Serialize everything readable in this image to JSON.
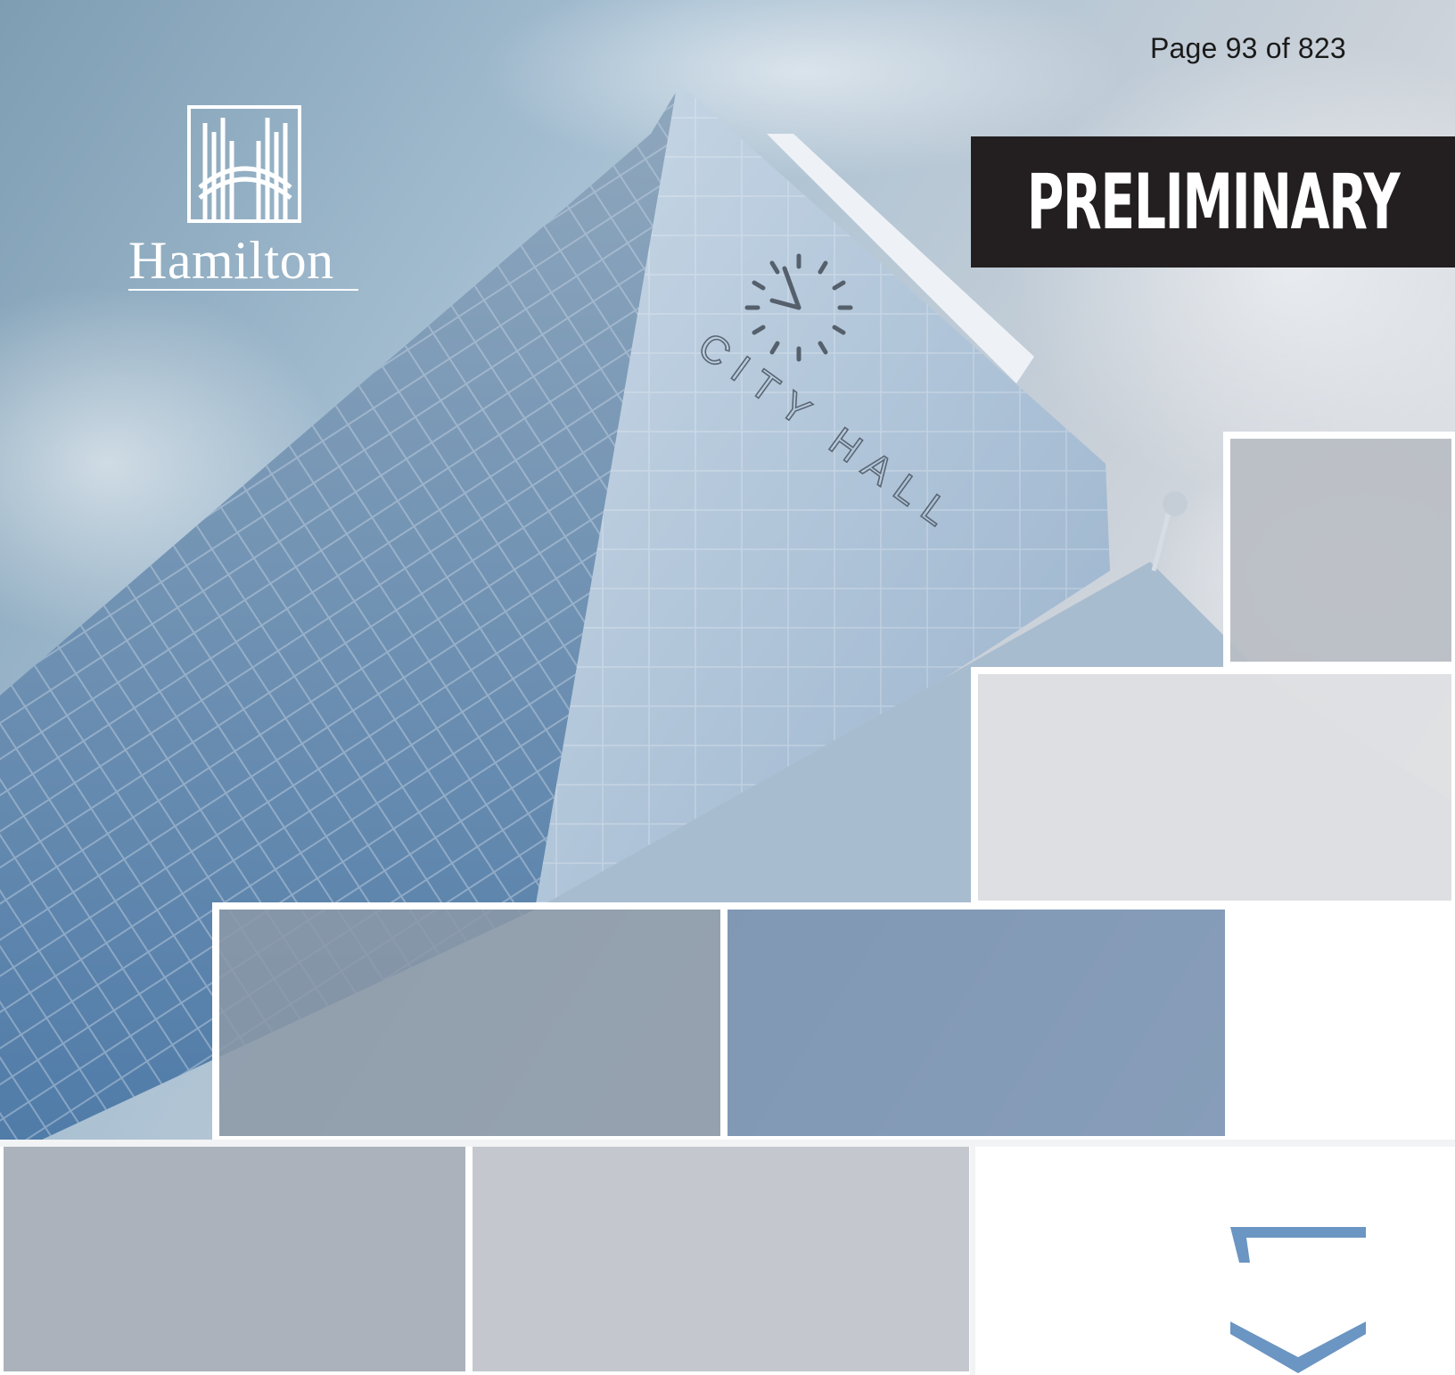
{
  "page_number": "Page 93 of 823",
  "banner": {
    "label": "PRELIMINARY"
  },
  "logo": {
    "wordmark": "Hamilton",
    "icon": "hamilton-h-icon"
  },
  "photo": {
    "sign_text": "CITY HALL"
  },
  "colors": {
    "banner_bg": "#231f20",
    "accent_blue": "#6b95c2",
    "sky_blue": "#8fb2cf",
    "tile_grey": "#b4bac4"
  }
}
